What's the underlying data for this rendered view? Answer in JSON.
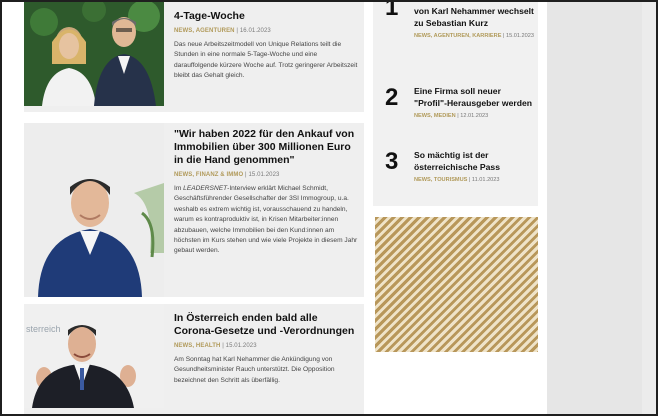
{
  "articles": [
    {
      "headline": "4-Tage-Woche",
      "meta_tags": "NEWS, AGENTUREN",
      "meta_date": "| 16.01.2023",
      "excerpt": "Das neue Arbeitszeitmodell von Unique Relations teilt die Stunden in eine normale 5-Tage-Woche und eine darauffolgende kürzere Woche auf. Trotz geringerer Arbeitszeit bleibt das Gehalt gleich."
    },
    {
      "headline": "\"Wir haben 2022 für den Ankauf von Immobilien über 300 Millionen Euro in die Hand genommen\"",
      "meta_tags": "NEWS, FINANZ & IMMO",
      "meta_date": "| 15.01.2023",
      "excerpt_prefix": "Im ",
      "excerpt_em": "LEADERSNET",
      "excerpt_rest": "-Interview erklärt Michael Schmidt, Geschäftsführender Gesellschafter der 3SI Immogroup, u.a. weshalb es extrem wichtig ist, vorausschauend zu handeln, warum es kontraproduktiv ist, in Krisen Mitarbeiter:innen abzubauen, welche Immobilien bei den Kund:innen am höchsten im Kurs stehen und wie viele Projekte in diesem Jahr gebaut werden."
    },
    {
      "headline": "In Österreich enden bald alle Corona-Gesetze und -Verordnungen",
      "meta_tags": "NEWS, HEALTH",
      "meta_date": "| 15.01.2023",
      "excerpt": "Am Sonntag hat Karl Nehammer die Ankündigung von Gesundheitsminister Rauch unterstützt. Die Opposition bezeichnet den Schritt als überfällig."
    }
  ],
  "photo_text": "sterreich",
  "ranking": [
    {
      "number": "1",
      "title": "von Karl Nehammer wechselt zu Sebastian Kurz",
      "meta_tags": "NEWS, AGENTUREN, KARRIERE",
      "meta_date": "| 15.01.2023"
    },
    {
      "number": "2",
      "title": "Eine Firma soll neuer \"Profil\"-Herausgeber werden",
      "meta_tags": "NEWS, MEDIEN",
      "meta_date": "| 12.01.2023"
    },
    {
      "number": "3",
      "title": "So mächtig ist der österreichische Pass",
      "meta_tags": "NEWS, TOURISMUS",
      "meta_date": "| 11.01.2023"
    }
  ],
  "colors": {
    "meta_gold": "#b19a5a",
    "card_bg": "#efefef",
    "ad_stripe": "#b8975a"
  }
}
